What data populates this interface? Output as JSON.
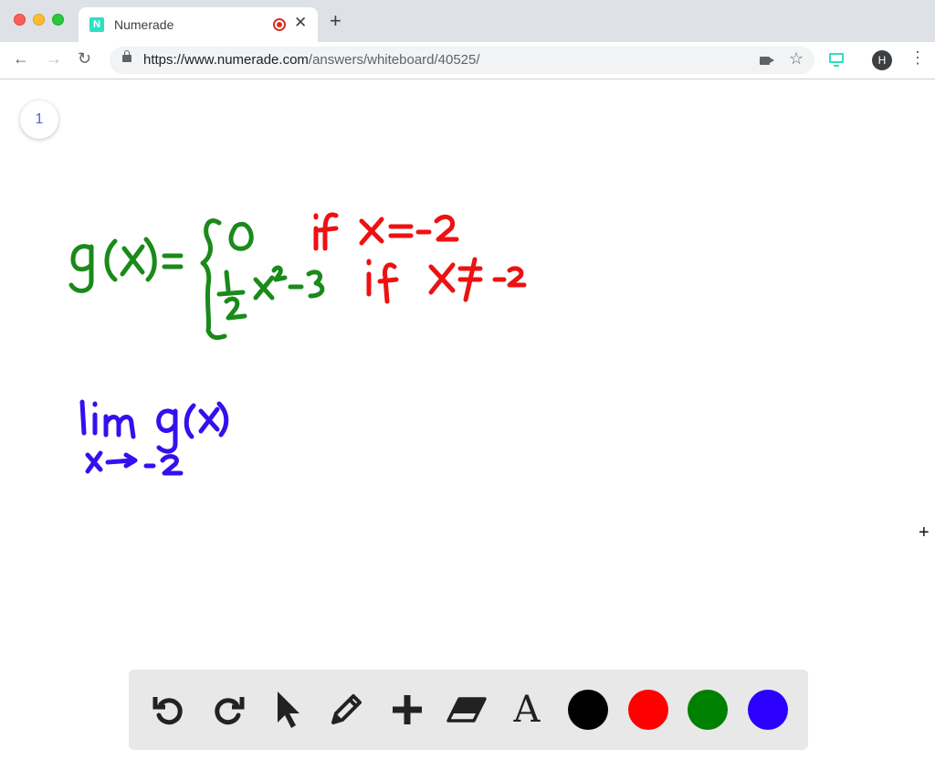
{
  "browser": {
    "tab_title": "Numerade",
    "favicon_letter": "N",
    "url_host": "https://www.numerade.com",
    "url_path": "/answers/whiteboard/40525/",
    "profile_initial": "H"
  },
  "whiteboard": {
    "page_number": "1",
    "handwriting": {
      "piecewise_function": "g(x) = { 0 if x = -2 ; ½x² - 3 if x ≠ -2 }",
      "limit_expression": "lim x→-2 g(x)"
    }
  },
  "toolbar": {
    "tools": [
      "undo",
      "redo",
      "select",
      "pen",
      "add",
      "eraser",
      "text"
    ],
    "text_tool_glyph": "A",
    "colors": [
      "#000000",
      "#ff0000",
      "#008000",
      "#2b00ff"
    ]
  },
  "colors": {
    "accent": "#2ce0c2",
    "ink_green": "#1a8a1a",
    "ink_red": "#ee1111",
    "ink_blue": "#3311ee"
  }
}
